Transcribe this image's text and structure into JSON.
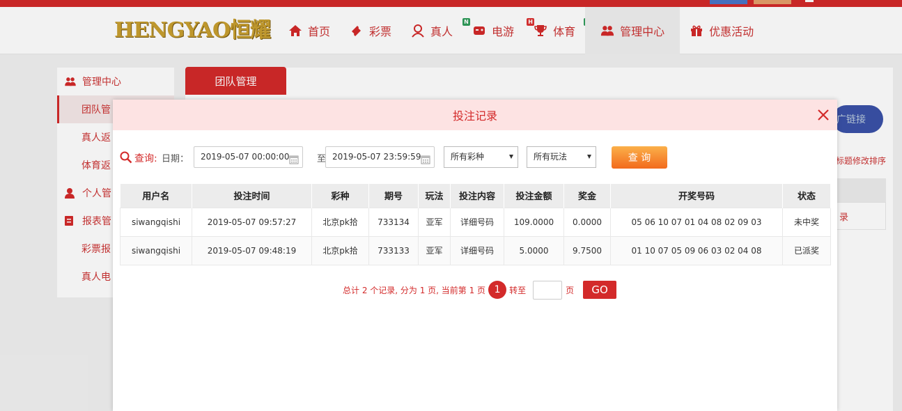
{
  "header": {
    "logo": "HENGYAO恒耀",
    "nav": [
      {
        "label": "首页",
        "icon": "home-icon"
      },
      {
        "label": "彩票",
        "icon": "ticket-icon"
      },
      {
        "label": "真人",
        "icon": "person-icon",
        "badge": "N"
      },
      {
        "label": "电游",
        "icon": "gamepad-icon",
        "badge": "H"
      },
      {
        "label": "体育",
        "icon": "trophy-icon",
        "badge": "N"
      },
      {
        "label": "管理中心",
        "icon": "users-icon"
      },
      {
        "label": "优惠活动",
        "icon": "gift-icon"
      }
    ]
  },
  "sidebar": {
    "section1": "管理中心",
    "items1": [
      "团队管",
      "真人返",
      "体育返"
    ],
    "section2": "个人管",
    "section3": "报表管",
    "items3": [
      "彩票报",
      "真人电"
    ]
  },
  "content": {
    "tab": "团队管理",
    "promo": "广链接",
    "sort_link": "标题修改排序",
    "right_cell": "录"
  },
  "modal": {
    "title": "投注记录",
    "query_label": "查询:",
    "date_label": "日期：",
    "date_from": "2019-05-07 00:00:00",
    "to_label": "至",
    "date_to": "2019-05-07 23:59:59",
    "lottery_select": "所有彩种",
    "play_select": "所有玩法",
    "query_button": "查 询",
    "columns": [
      "用户名",
      "投注时间",
      "彩种",
      "期号",
      "玩法",
      "投注内容",
      "投注金额",
      "奖金",
      "开奖号码",
      "状态"
    ],
    "rows": [
      {
        "user": "siwangqishi",
        "time": "2019-05-07 09:57:27",
        "lottery": "北京pk拾",
        "issue": "733134",
        "play": "亚军",
        "content": "详细号码",
        "amount": "109.0000",
        "prize": "0.0000",
        "numbers": "05 06 10 07 01 04 08 02 09 03",
        "status": "未中奖"
      },
      {
        "user": "siwangqishi",
        "time": "2019-05-07 09:48:19",
        "lottery": "北京pk拾",
        "issue": "733133",
        "play": "亚军",
        "content": "详细号码",
        "amount": "5.0000",
        "prize": "9.7500",
        "numbers": "01 10 07 05 09 06 03 02 04 08",
        "status": "已派奖"
      }
    ],
    "pager": {
      "summary": "总计 2 个记录, 分为 1 页, 当前第 1 页",
      "current": "1",
      "goto": "转至",
      "page_unit": "页",
      "go": "GO"
    }
  },
  "colors": {
    "brand": "#d32a2a",
    "modal_header": "#fde3e3",
    "link_green": "#2a9a2a"
  }
}
